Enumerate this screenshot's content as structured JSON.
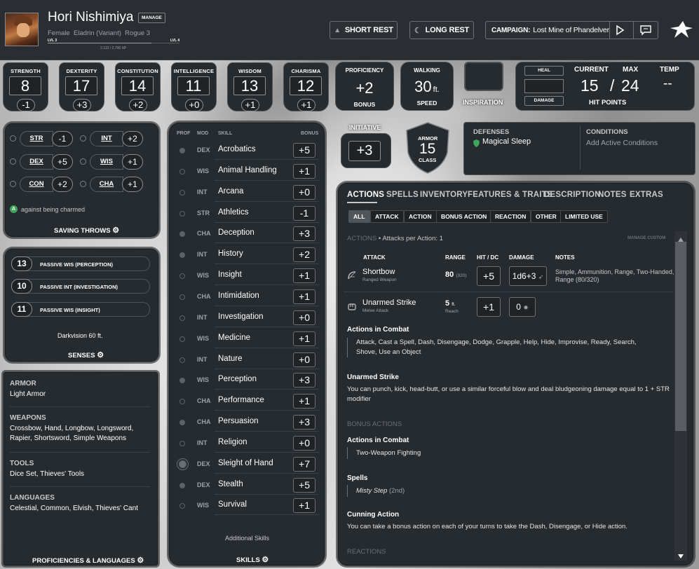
{
  "header": {
    "name": "Hori Nishimiya",
    "manage_label": "MANAGE",
    "subtitle": "Female  Eladrin (Variant)  Rogue 3",
    "lvl_left": "LVL 3",
    "lvl_right": "LVL 4",
    "xp": "2,122 / 2,700 XP",
    "short_rest": "SHORT REST",
    "long_rest": "LONG REST",
    "campaign_label": "CAMPAIGN:",
    "campaign_name": "Lost Mine of Phandelver"
  },
  "abilities": [
    {
      "label": "STRENGTH",
      "score": "8",
      "mod": "-1"
    },
    {
      "label": "DEXTERITY",
      "score": "17",
      "mod": "+3"
    },
    {
      "label": "CONSTITUTION",
      "score": "14",
      "mod": "+2"
    },
    {
      "label": "INTELLIGENCE",
      "score": "11",
      "mod": "+0"
    },
    {
      "label": "WISDOM",
      "score": "13",
      "mod": "+1"
    },
    {
      "label": "CHARISMA",
      "score": "12",
      "mod": "+1"
    }
  ],
  "proficiency": {
    "label": "PROFICIENCY",
    "value": "+2",
    "sub": "BONUS"
  },
  "walking": {
    "label": "WALKING",
    "value": "30",
    "unit": "ft.",
    "sub": "SPEED"
  },
  "inspiration": {
    "label": "INSPIRATION"
  },
  "hp": {
    "heal": "HEAL",
    "damage": "DAMAGE",
    "current_label": "CURRENT",
    "max_label": "MAX",
    "temp_label": "TEMP",
    "current": "15",
    "slash": "/",
    "max": "24",
    "temp": "--",
    "title": "HIT POINTS"
  },
  "initiative": {
    "label": "INITIATIVE",
    "value": "+3"
  },
  "armor": {
    "top": "ARMOR",
    "value": "15",
    "bottom": "CLASS"
  },
  "defenses": {
    "label": "DEFENSES",
    "item": "Magical Sleep"
  },
  "conditions": {
    "label": "CONDITIONS",
    "placeholder": "Add Active Conditions"
  },
  "saving_throws": {
    "rows": [
      {
        "ab": "STR",
        "bonus": "-1"
      },
      {
        "ab": "INT",
        "bonus": "+2"
      },
      {
        "ab": "DEX",
        "bonus": "+5"
      },
      {
        "ab": "WIS",
        "bonus": "+1"
      },
      {
        "ab": "CON",
        "bonus": "+2"
      },
      {
        "ab": "CHA",
        "bonus": "+1"
      }
    ],
    "advantage_badge": "A",
    "note": "against being charmed",
    "title": "SAVING THROWS"
  },
  "senses": {
    "passives": [
      {
        "value": "13",
        "label": "PASSIVE WIS (PERCEPTION)"
      },
      {
        "value": "10",
        "label": "PASSIVE INT (INVESTIGATION)"
      },
      {
        "value": "11",
        "label": "PASSIVE WIS (INSIGHT)"
      }
    ],
    "darkvision": "Darkvision 60 ft.",
    "title": "SENSES"
  },
  "proficiencies": {
    "groups": [
      {
        "label": "ARMOR",
        "text": "Light Armor"
      },
      {
        "label": "WEAPONS",
        "text": "Crossbow, Hand, Longbow, Longsword, Rapier, Shortsword, Simple Weapons"
      },
      {
        "label": "TOOLS",
        "text": "Dice Set, Thieves' Tools"
      },
      {
        "label": "LANGUAGES",
        "text": "Celestial, Common, Elvish, Thieves' Cant"
      }
    ],
    "title": "PROFICIENCIES & LANGUAGES"
  },
  "skills": {
    "headers": {
      "prof": "PROF",
      "mod": "MOD",
      "skill": "SKILL",
      "bonus": "BONUS"
    },
    "rows": [
      {
        "mod": "DEX",
        "name": "Acrobatics",
        "bonus": "+5",
        "prof": "p"
      },
      {
        "mod": "WIS",
        "name": "Animal Handling",
        "bonus": "+1",
        "prof": ""
      },
      {
        "mod": "INT",
        "name": "Arcana",
        "bonus": "+0",
        "prof": ""
      },
      {
        "mod": "STR",
        "name": "Athletics",
        "bonus": "-1",
        "prof": ""
      },
      {
        "mod": "CHA",
        "name": "Deception",
        "bonus": "+3",
        "prof": "p"
      },
      {
        "mod": "INT",
        "name": "History",
        "bonus": "+2",
        "prof": "p"
      },
      {
        "mod": "WIS",
        "name": "Insight",
        "bonus": "+1",
        "prof": ""
      },
      {
        "mod": "CHA",
        "name": "Intimidation",
        "bonus": "+1",
        "prof": ""
      },
      {
        "mod": "INT",
        "name": "Investigation",
        "bonus": "+0",
        "prof": ""
      },
      {
        "mod": "WIS",
        "name": "Medicine",
        "bonus": "+1",
        "prof": ""
      },
      {
        "mod": "INT",
        "name": "Nature",
        "bonus": "+0",
        "prof": ""
      },
      {
        "mod": "WIS",
        "name": "Perception",
        "bonus": "+3",
        "prof": "p"
      },
      {
        "mod": "CHA",
        "name": "Performance",
        "bonus": "+1",
        "prof": ""
      },
      {
        "mod": "CHA",
        "name": "Persuasion",
        "bonus": "+3",
        "prof": "p"
      },
      {
        "mod": "INT",
        "name": "Religion",
        "bonus": "+0",
        "prof": ""
      },
      {
        "mod": "DEX",
        "name": "Sleight of Hand",
        "bonus": "+7",
        "prof": "e"
      },
      {
        "mod": "DEX",
        "name": "Stealth",
        "bonus": "+5",
        "prof": "p"
      },
      {
        "mod": "WIS",
        "name": "Survival",
        "bonus": "+1",
        "prof": ""
      }
    ],
    "additional": "Additional Skills",
    "title": "SKILLS"
  },
  "tabs": [
    "ACTIONS",
    "SPELLS",
    "INVENTORY",
    "FEATURES & TRAITS",
    "DESCRIPTION",
    "NOTES",
    "EXTRAS"
  ],
  "filters": [
    "ALL",
    "ACTION",
    "ACTION",
    "BONUS ACTION",
    "REACTION",
    "OTHER",
    "LIMITED USE"
  ],
  "filters_fixed": [
    "ALL",
    "ATTACK",
    "ACTION",
    "BONUS ACTION",
    "REACTION",
    "OTHER",
    "LIMITED USE"
  ],
  "actions": {
    "section_label": "ACTIONS",
    "section_sub": "• Attacks per Action: 1",
    "manage_custom": "MANAGE CUSTOM",
    "cols": {
      "attack": "ATTACK",
      "range": "RANGE",
      "hit": "HIT / DC",
      "damage": "DAMAGE",
      "notes": "NOTES"
    },
    "attacks": [
      {
        "name": "Shortbow",
        "type": "Ranged Weapon",
        "range": "80",
        "range_sub": "(320)",
        "hit": "+5",
        "damage": "1d6+3",
        "notes": "Simple, Ammunition, Range, Two-Handed, Range (80/320)"
      },
      {
        "name": "Unarmed Strike",
        "type": "Melee Attack",
        "range": "5",
        "range_unit": "ft.",
        "range_sub": "Reach",
        "hit": "+1",
        "damage": "0",
        "notes": ""
      }
    ],
    "combat_title": "Actions in Combat",
    "combat_list": "Attack, Cast a Spell, Dash, Disengage, Dodge, Grapple, Help, Hide, Improvise, Ready, Search, Shove, Use an Object",
    "unarmed_title": "Unarmed Strike",
    "unarmed_text": "You can punch, kick, head-butt, or use a similar forceful blow and deal bludgeoning damage equal to 1 + STR modifier",
    "bonus_label": "BONUS ACTIONS",
    "bonus_combat_title": "Actions in Combat",
    "bonus_combat_list": "Two-Weapon Fighting",
    "spells_title": "Spells",
    "spell_name": "Misty Step",
    "spell_level": "(2nd)",
    "cunning_title": "Cunning Action",
    "cunning_text": "You can take a bonus action on each of your turns to take the Dash, Disengage, or Hide action.",
    "reactions_label": "REACTIONS"
  }
}
